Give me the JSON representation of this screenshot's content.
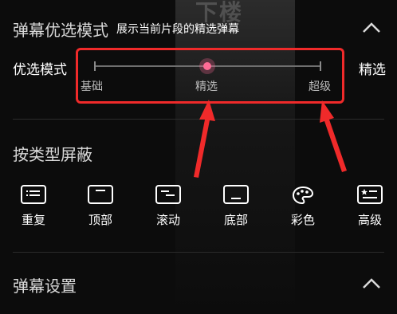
{
  "background_watermark": "下楼",
  "danmaku_mode": {
    "title": "弹幕优选模式",
    "subtitle": "展示当前片段的精选弹幕",
    "mode_label": "优选模式",
    "current_value": "精选",
    "slider": {
      "options": [
        "基础",
        "精选",
        "超级"
      ],
      "selected": "精选",
      "accent_color": "#ff6b96"
    }
  },
  "block_by_type": {
    "title": "按类型屏蔽",
    "filters": [
      {
        "label": "重复",
        "icon": "repeat-lines-icon"
      },
      {
        "label": "顶部",
        "icon": "top-bar-icon"
      },
      {
        "label": "滚动",
        "icon": "scroll-lines-icon"
      },
      {
        "label": "底部",
        "icon": "bottom-bar-icon"
      },
      {
        "label": "彩色",
        "icon": "palette-icon"
      },
      {
        "label": "高级",
        "icon": "advanced-star-icon"
      }
    ]
  },
  "settings": {
    "title": "弹幕设置"
  },
  "annotation_color": "#f02a2a"
}
